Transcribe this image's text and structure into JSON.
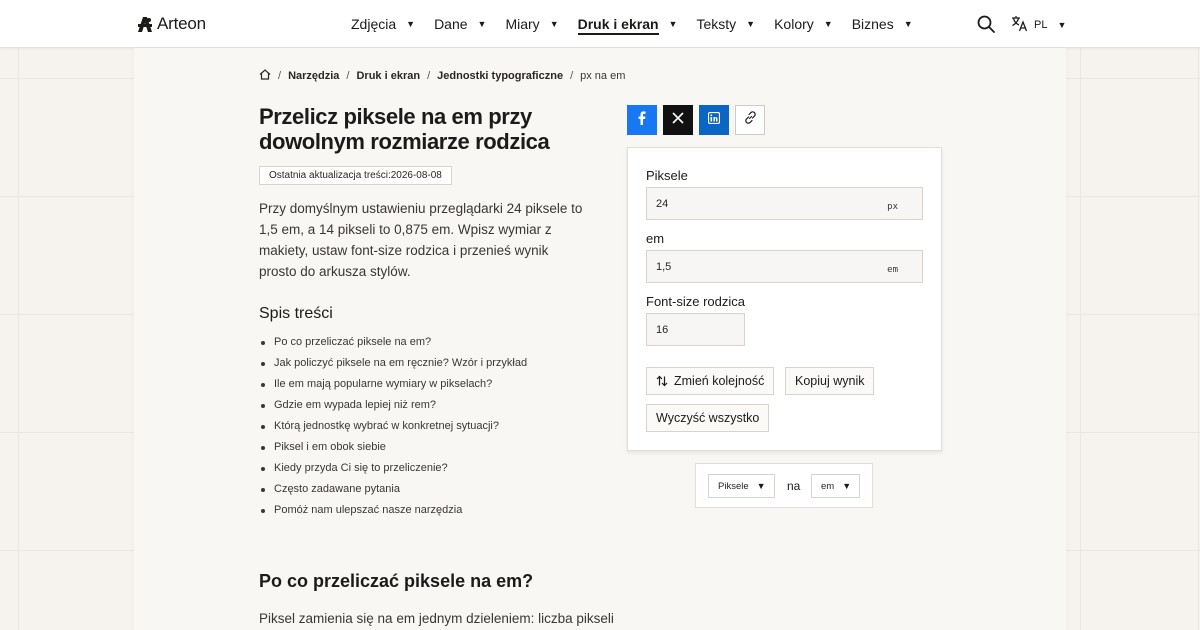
{
  "header": {
    "logo_text": "Arteon",
    "nav": [
      {
        "label": "Zdjęcia",
        "active": false
      },
      {
        "label": "Dane",
        "active": false
      },
      {
        "label": "Miary",
        "active": false
      },
      {
        "label": "Druk i ekran",
        "active": true
      },
      {
        "label": "Teksty",
        "active": false
      },
      {
        "label": "Kolory",
        "active": false
      },
      {
        "label": "Biznes",
        "active": false
      }
    ],
    "language": "PL",
    "caret": "▼"
  },
  "breadcrumb": {
    "items": [
      "Narzędzia",
      "Druk i ekran",
      "Jednostki typograficzne"
    ],
    "current": "px na em",
    "separator": "/"
  },
  "article": {
    "title": "Przelicz piksele na em przy dowolnym rozmiarze rodzica",
    "updated": "Ostatnia aktualizacja treści:2026-08-08",
    "intro": "Przy domyślnym ustawieniu przeglądarki 24 piksele to 1,5 em, a 14 pikseli to 0,875 em. Wpisz wymiar z makiety, ustaw font-size rodzica i przenieś wynik prosto do arkusza stylów.",
    "toc_title": "Spis treści",
    "toc": [
      "Po co przeliczać piksele na em?",
      "Jak policzyć piksele na em ręcznie? Wzór i przykład",
      "Ile em mają popularne wymiary w pikselach?",
      "Gdzie em wypada lepiej niż rem?",
      "Którą jednostkę wybrać w konkretnej sytuacji?",
      "Piksel i em obok siebie",
      "Kiedy przyda Ci się to przeliczenie?",
      "Często zadawane pytania",
      "Pomóż nam ulepszać nasze narzędzia"
    ],
    "section_heading": "Po co przeliczać piksele na em?",
    "section_text": "Piksel zamienia się na em jednym dzieleniem: liczba pikseli"
  },
  "converter": {
    "pixels_label": "Piksele",
    "pixels_value": "24",
    "pixels_unit": "px",
    "em_label": "em",
    "em_value": "1,5",
    "em_unit": "em",
    "parent_label": "Font-size rodzica",
    "parent_value": "16",
    "swap_button": "Zmień kolejność",
    "copy_button": "Kopiuj wynik",
    "clear_button": "Wyczyść wszystko"
  },
  "unit_selector": {
    "from": "Piksele",
    "connector": "na",
    "to": "em"
  },
  "colors": {
    "facebook": "#1877f2",
    "x": "#111111",
    "linkedin": "#0a66c2",
    "text": "#1d1b19",
    "background": "#f6f3ef"
  },
  "icons": [
    "logo-icon",
    "search-icon",
    "translate-icon",
    "home-icon",
    "facebook-icon",
    "x-icon",
    "linkedin-icon",
    "link-icon",
    "swap-icon"
  ]
}
